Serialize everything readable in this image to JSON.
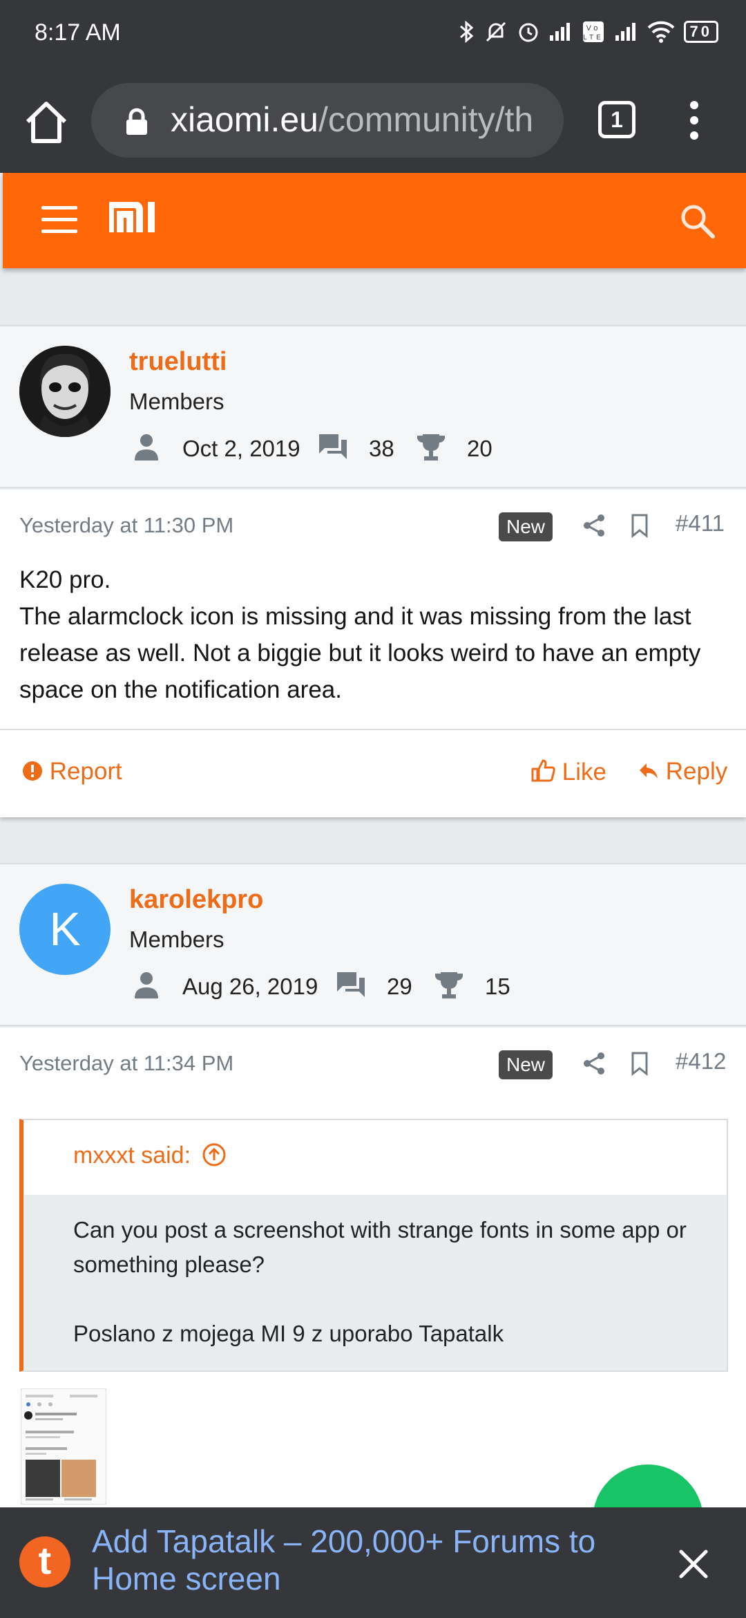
{
  "status_bar": {
    "time": "8:17 AM",
    "battery": "70"
  },
  "browser": {
    "url_domain": "xiaomi.eu",
    "url_path": "/community/th",
    "tab_count": "1"
  },
  "posts": [
    {
      "username": "truelutti",
      "role": "Members",
      "joined": "Oct 2, 2019",
      "messages": "38",
      "trophies": "20",
      "date": "Yesterday at 11:30 PM",
      "badge": "New",
      "post_number": "#411",
      "text_line1": "K20 pro.",
      "text_line2": "The alarmclock icon is missing and it was missing from the last release as well. Not a biggie but it looks weird to have an empty space on the notification area.",
      "report_label": "Report",
      "like_label": "Like",
      "reply_label": "Reply"
    },
    {
      "username": "karolekpro",
      "avatar_letter": "K",
      "role": "Members",
      "joined": "Aug 26, 2019",
      "messages": "29",
      "trophies": "15",
      "date": "Yesterday at 11:34 PM",
      "badge": "New",
      "post_number": "#412",
      "quote_author": "mxxxt said:",
      "quote_line1": "Can you post a screenshot with strange fonts in some app or something please?",
      "quote_line2": "Poslano z mojega MI 9 z uporabo Tapatalk"
    }
  ],
  "banner": {
    "logo_letter": "t",
    "text": "Add Tapatalk – 200,000+ Forums to Home screen"
  },
  "colors": {
    "brand_orange": "#ff6709",
    "link_orange": "#ee6b17",
    "chrome_dark": "#35373a",
    "avatar_blue": "#42a5f5",
    "fab_green": "#19c466"
  }
}
